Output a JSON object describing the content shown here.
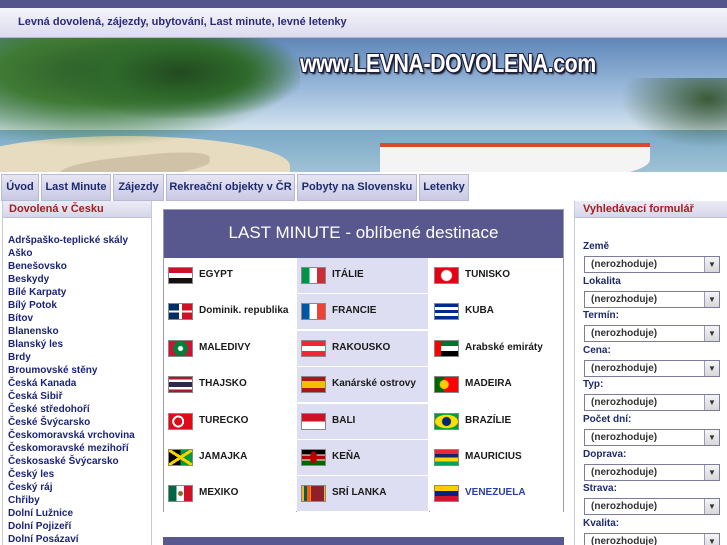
{
  "header": {
    "tagline": "Levná dovolená, zájezdy, ubytování, Last minute, levné letenky",
    "site_title": "www.LEVNA-DOVOLENA.com"
  },
  "nav": {
    "items": [
      "Úvod",
      "Last Minute",
      "Zájezdy",
      "Rekreační objekty v ČR",
      "Pobyty na Slovensku",
      "Letenky"
    ]
  },
  "sidebar": {
    "title": "Dovolená v Česku",
    "items": [
      "Adršpaško-teplické skály",
      "Aško",
      "Benešovsko",
      "Beskydy",
      "Bílé Karpaty",
      "Bílý Potok",
      "Bítov",
      "Blanensko",
      "Blanský les",
      "Brdy",
      "Broumovské stěny",
      "Česká Kanada",
      "Česká Sibiř",
      "České středohoří",
      "České Švýcarsko",
      "Českomoravská vrchovina",
      "Českomoravské mezihoří",
      "Českosaské Švýcarsko",
      "Český les",
      "Český ráj",
      "Chřiby",
      "Dolní Lužnice",
      "Dolní Pojizeří",
      "Dolní Posázaví"
    ]
  },
  "main": {
    "heading": "LAST MINUTE - oblíbené destinace",
    "destinations": [
      {
        "name": "EGYPT",
        "flag": "egypt-flag"
      },
      {
        "name": "ITÁLIE",
        "flag": "italy-flag"
      },
      {
        "name": "TUNISKO",
        "flag": "tunisia-flag"
      },
      {
        "name": "Dominik. republika",
        "flag": "dominican-republic-flag"
      },
      {
        "name": "FRANCIE",
        "flag": "france-flag"
      },
      {
        "name": "KUBA",
        "flag": "cuba-flag"
      },
      {
        "name": "MALEDIVY",
        "flag": "maldives-flag"
      },
      {
        "name": "RAKOUSKO",
        "flag": "austria-flag"
      },
      {
        "name": "Arabské emiráty",
        "flag": "uae-flag"
      },
      {
        "name": "THAJSKO",
        "flag": "thailand-flag"
      },
      {
        "name": "Kanárské ostrovy",
        "flag": "canary-islands-flag"
      },
      {
        "name": "MADEIRA",
        "flag": "portugal-flag"
      },
      {
        "name": "TURECKO",
        "flag": "turkey-flag"
      },
      {
        "name": "BALI",
        "flag": "indonesia-flag"
      },
      {
        "name": "BRAZÍLIE",
        "flag": "brazil-flag"
      },
      {
        "name": "JAMAJKA",
        "flag": "jamaica-flag"
      },
      {
        "name": "KEŇA",
        "flag": "kenya-flag"
      },
      {
        "name": "MAURICIUS",
        "flag": "mauritius-flag"
      },
      {
        "name": "MEXIKO",
        "flag": "mexico-flag"
      },
      {
        "name": "SRÍ LANKA",
        "flag": "sri-lanka-flag"
      },
      {
        "name": "VENEZUELA",
        "flag": "venezuela-flag"
      }
    ]
  },
  "search_form": {
    "title": "Vyhledávací formulář",
    "fields": [
      {
        "label": "Země",
        "value": "(nerozhoduje)"
      },
      {
        "label": "Lokalita",
        "value": "(nerozhoduje)"
      },
      {
        "label": "Termín:",
        "value": "(nerozhoduje)"
      },
      {
        "label": "Cena:",
        "value": "(nerozhoduje)"
      },
      {
        "label": "Typ:",
        "value": "(nerozhoduje)"
      },
      {
        "label": "Počet dní:",
        "value": "(nerozhoduje)"
      },
      {
        "label": "Doprava:",
        "value": "(nerozhoduje)"
      },
      {
        "label": "Strava:",
        "value": "(nerozhoduje)"
      },
      {
        "label": "Kvalita:",
        "value": "(nerozhoduje)"
      }
    ]
  }
}
